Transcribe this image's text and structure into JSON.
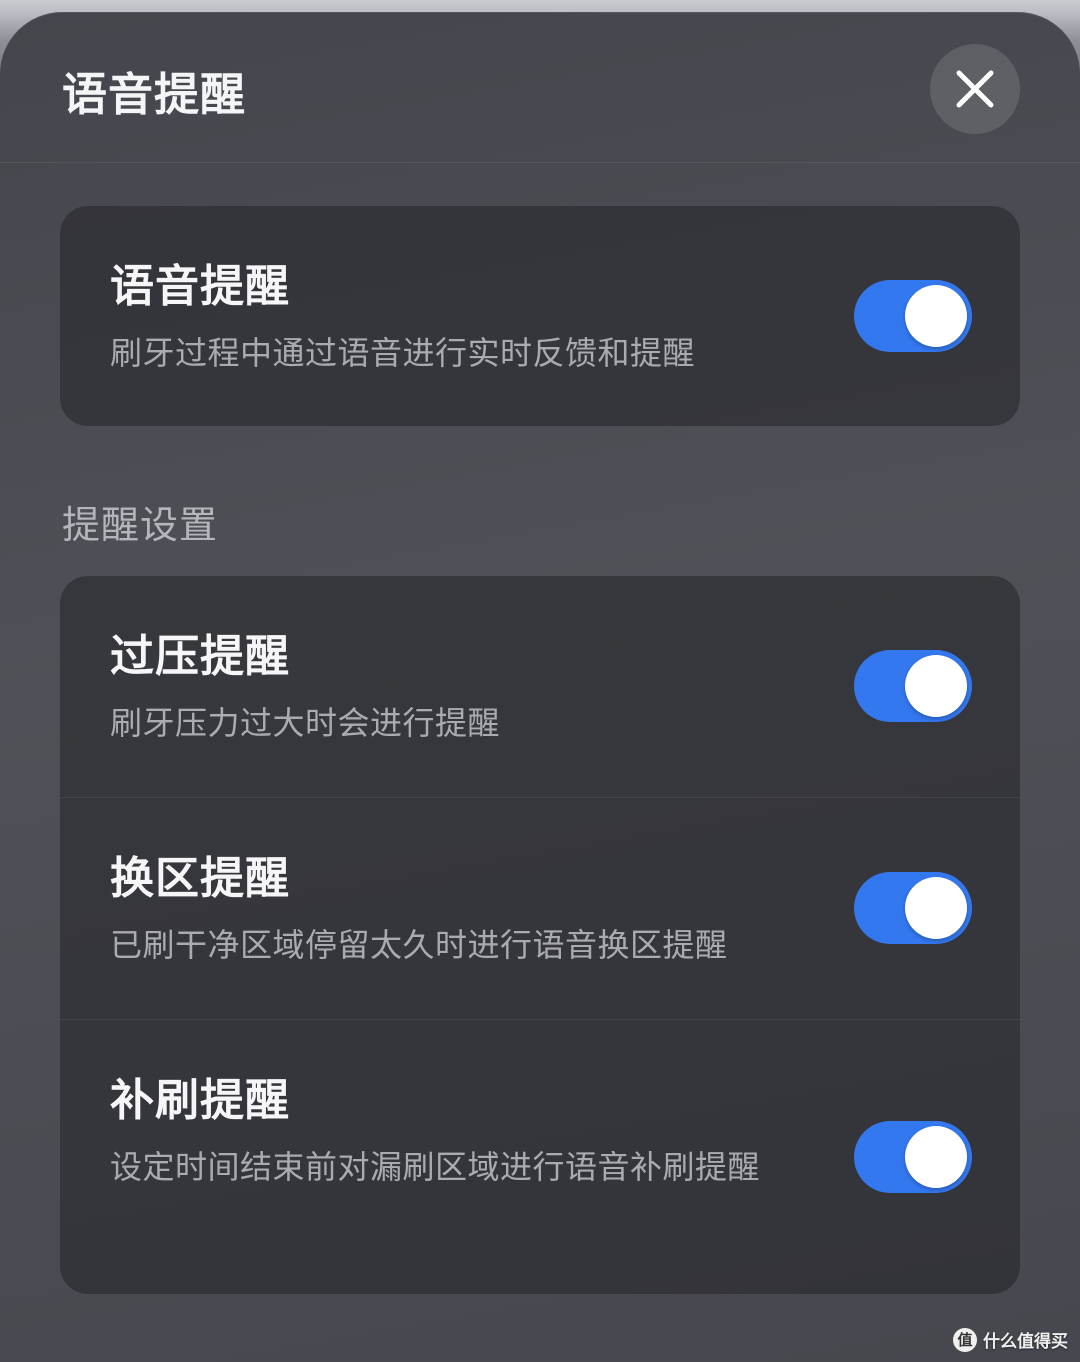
{
  "header": {
    "title": "语音提醒"
  },
  "voice_card": {
    "label": "语音提醒",
    "description": "刷牙过程中通过语音进行实时反馈和提醒",
    "enabled": true
  },
  "section": {
    "label": "提醒设置"
  },
  "reminders": [
    {
      "label": "过压提醒",
      "description": "刷牙压力过大时会进行提醒",
      "enabled": true
    },
    {
      "label": "换区提醒",
      "description": "已刷干净区域停留太久时进行语音换区提醒",
      "enabled": true
    },
    {
      "label": "补刷提醒",
      "description": "设定时间结束前对漏刷区域进行语音补刷提醒",
      "enabled": true
    }
  ],
  "watermark": {
    "glyph": "值",
    "text": "什么值得买"
  },
  "colors": {
    "toggle_on": "#3478f0",
    "knob": "#ffffff"
  }
}
